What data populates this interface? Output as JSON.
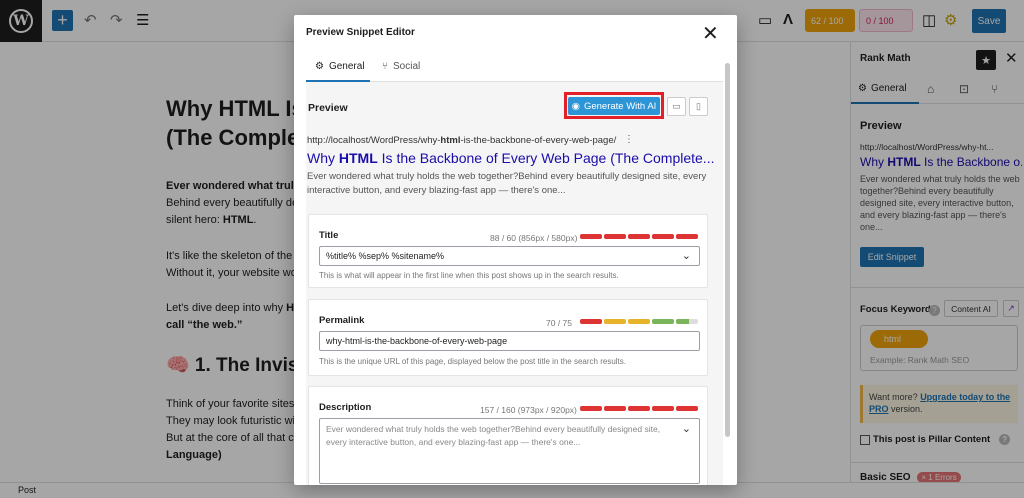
{
  "toolbar": {
    "wp_logo": "W",
    "add_icon": "+",
    "undo_icon": "↶",
    "redo_icon": "↷",
    "list_icon": "☰",
    "desktop_icon": "▭",
    "rankmath_icon": "Λ",
    "score_orange": "62 / 100",
    "score_pink": "0 / 100",
    "sidebar_toggle_icon": "◫",
    "settings_icon": "⚙",
    "save_label": "Save"
  },
  "post": {
    "title_line1": "Why HTML Is",
    "title_line2": "(The Complet",
    "p1_bold": "Ever wondered what truly",
    "p1_line2": "Behind every beautifully de",
    "p1_line3_prefix": "silent hero: ",
    "p1_line3_bold": "HTML",
    "p1_line3_suffix": ".",
    "p2_line1": "It's like the skeleton of the",
    "p2_line2": "Without it, your website wo",
    "p3_line1_prefix": "Let's dive deep into why ",
    "p3_line1_bold": "H",
    "p3_line2_bold": "call “the web.”",
    "h2": "🧠 1. The Invis",
    "p4_line1": "Think of your favorite sites",
    "p4_line2": "They may look futuristic wi",
    "p4_line3": "But at the core of all that c",
    "p4_line4_bold": "Language)"
  },
  "modal": {
    "title": "Preview Snippet Editor",
    "close_icon": "✕",
    "tab_general": "General",
    "tab_social": "Social",
    "tab_general_icon": "⚙",
    "tab_social_icon": "⑂",
    "preview_label": "Preview",
    "generate_ai_label": "Generate With AI",
    "generate_ai_icon": "◉",
    "desktop_icon": "▭",
    "mobile_icon": "▯",
    "url_prefix": "http://localhost/WordPress/why-",
    "url_bold": "html",
    "url_suffix": "-is-the-backbone-of-every-web-page/",
    "url_menu_icon": "⋮",
    "link_prefix": "Why ",
    "link_bold": "HTML",
    "link_suffix": " Is the Backbone of Every Web Page (The Complete...",
    "description": "Ever wondered what truly holds the web together?Behind every beautifully designed site, every interactive button, and every blazing-fast app — there's one...",
    "title_field": {
      "label": "Title",
      "count": "88 / 60 (856px / 580px)",
      "value": "%title% %sep% %sitename%",
      "hint": "This is what will appear in the first line when this post shows up in the search results."
    },
    "permalink_field": {
      "label": "Permalink",
      "count": "70 / 75",
      "value": "why-html-is-the-backbone-of-every-web-page",
      "hint": "This is the unique URL of this page, displayed below the post title in the search results."
    },
    "description_field": {
      "label": "Description",
      "count": "157 / 160 (973px / 920px)",
      "value": "Ever wondered what truly holds the web together?Behind every beautifully designed site, every interactive button, and every blazing-fast app — there's one..."
    },
    "chevron_icon": "⌄"
  },
  "sidebar": {
    "title": "Rank Math",
    "star_icon": "★",
    "close_icon": "✕",
    "tab_general": "General",
    "tab_general_icon": "⚙",
    "tab_advanced_icon": "⌂",
    "tab_schema_icon": "⊡",
    "tab_social_icon": "⑂",
    "preview_title": "Preview",
    "url": "http://localhost/WordPress/why-ht...",
    "link_prefix": "Why ",
    "link_bold": "HTML",
    "link_suffix": " Is the Backbone o...",
    "description": "Ever wondered what truly holds the web together?Behind every beautifully designed site, every interactive button, and every blazing-fast app — there's one...",
    "edit_snippet": "Edit Snippet",
    "focus_keyword_label": "Focus Keyword",
    "help_icon": "?",
    "content_ai": "Content AI",
    "keyword_tag": "html",
    "keyword_placeholder": "Example: Rank Math SEO",
    "upgrade_prefix": "Want more? ",
    "upgrade_link": "Upgrade today to the PRO",
    "upgrade_suffix": " version.",
    "pillar_label": "This post is Pillar Content",
    "basic_seo": "Basic SEO",
    "basic_seo_errors": "× 1 Errors"
  },
  "statusbar": {
    "label": "Post"
  },
  "colors": {
    "accent": "#1e74b3",
    "ai_button": "#2d95d6",
    "highlight_frame": "#e1202a",
    "bar_red": "#dd3333",
    "bar_green": "#7ab55c",
    "bar_yellow": "#e6b32b",
    "score_orange": "#f0a30a"
  }
}
